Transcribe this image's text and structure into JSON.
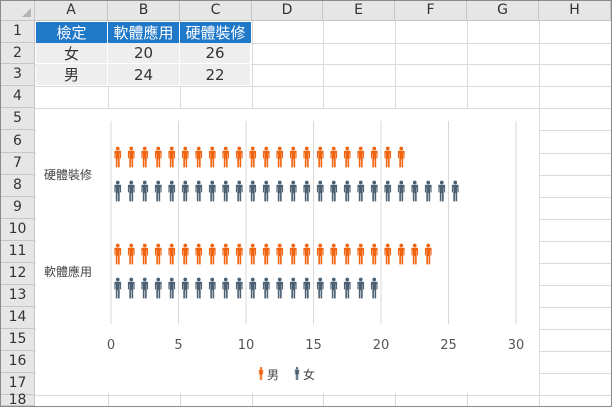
{
  "sheet": {
    "columns": [
      "A",
      "B",
      "C",
      "D",
      "E",
      "F",
      "G",
      "H"
    ],
    "rows": [
      "1",
      "2",
      "3",
      "4",
      "5",
      "6",
      "7",
      "8",
      "9",
      "10",
      "11",
      "12",
      "13",
      "14",
      "15",
      "16",
      "17",
      "18"
    ]
  },
  "table": {
    "headers": [
      "檢定",
      "軟體應用",
      "硬體裝修"
    ],
    "rows": [
      [
        "女",
        "20",
        "26"
      ],
      [
        "男",
        "24",
        "22"
      ]
    ]
  },
  "chart_data": {
    "type": "bar",
    "orientation": "horizontal",
    "categories": [
      "軟體應用",
      "硬體裝修"
    ],
    "series": [
      {
        "name": "男",
        "values": [
          24,
          22
        ],
        "color": "#f0640f",
        "icon": "person-icon"
      },
      {
        "name": "女",
        "values": [
          20,
          26
        ],
        "color": "#4b6072",
        "icon": "person-icon"
      }
    ],
    "xlim": [
      0,
      30
    ],
    "xticks": [
      "0",
      "5",
      "10",
      "15",
      "20",
      "25",
      "30"
    ],
    "grid": true,
    "legend": "bottom"
  }
}
